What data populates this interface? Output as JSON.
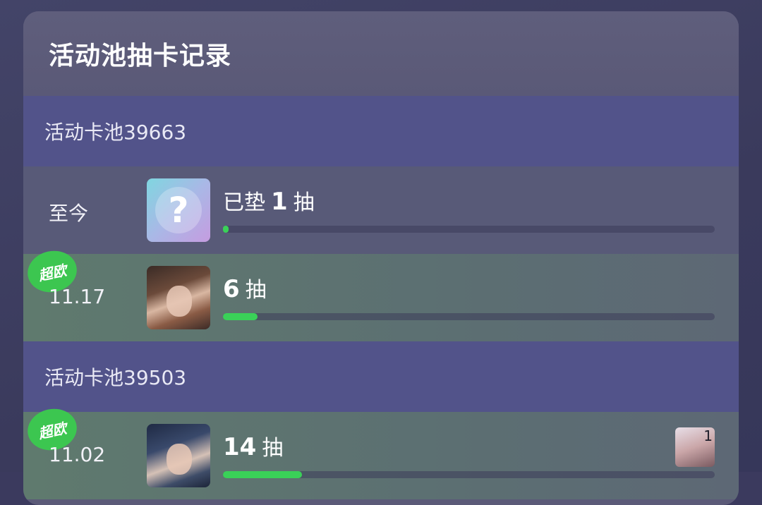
{
  "title": "活动池抽卡记录",
  "pools": [
    {
      "name": "活动卡池39663",
      "rows": [
        {
          "kind": "pending",
          "date": "至今",
          "prefix": "已垫",
          "count": "1",
          "unit": "抽",
          "progress": 0.01,
          "icon": "question-mark-icon"
        },
        {
          "kind": "lucky",
          "badge": "超欧",
          "date": "11.17",
          "count": "6",
          "unit": "抽",
          "progress": 0.07,
          "icon": "character-card-portrait"
        }
      ]
    },
    {
      "name": "活动卡池39503",
      "rows": [
        {
          "kind": "lucky",
          "badge": "超欧",
          "date": "11.02",
          "count": "14",
          "unit": "抽",
          "progress": 0.16,
          "icon": "character-card-portrait",
          "extra_count": "1"
        }
      ]
    }
  ],
  "colors": {
    "pool_header": "#52538a",
    "lucky_badge": "#3cc650",
    "progress_fill": "#3ad158"
  }
}
